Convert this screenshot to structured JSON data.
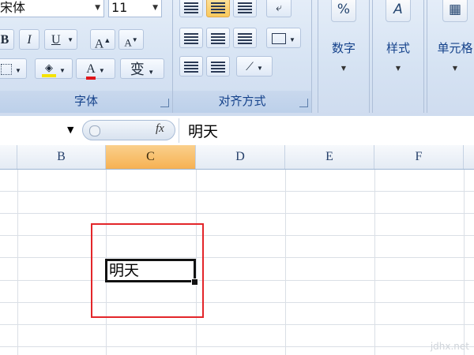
{
  "ribbon": {
    "font_group": {
      "font_name": "宋体",
      "font_size": "11",
      "bold_label": "B",
      "italic_label": "I",
      "underline_label": "U",
      "grow_font_label": "A",
      "shrink_font_label": "A",
      "font_color_label": "A",
      "phonetic_label": "变",
      "group_label": "字体"
    },
    "alignment_group": {
      "group_label": "对齐方式"
    },
    "number_group": {
      "icon_symbol": "%",
      "label": "数字"
    },
    "styles_group": {
      "icon_symbol": "A",
      "label": "样式"
    },
    "cells_group": {
      "label": "单元格"
    }
  },
  "formula_bar": {
    "fx_label": "fx",
    "value": "明天"
  },
  "columns": [
    "B",
    "C",
    "D",
    "E",
    "F"
  ],
  "active_column": "C",
  "active_cell": {
    "value": "明天"
  },
  "watermark": "jdhx.net",
  "colors": {
    "highlight_box": "#e3262a",
    "active_column_header": "#f6b153",
    "ribbon_text": "#15428b"
  }
}
